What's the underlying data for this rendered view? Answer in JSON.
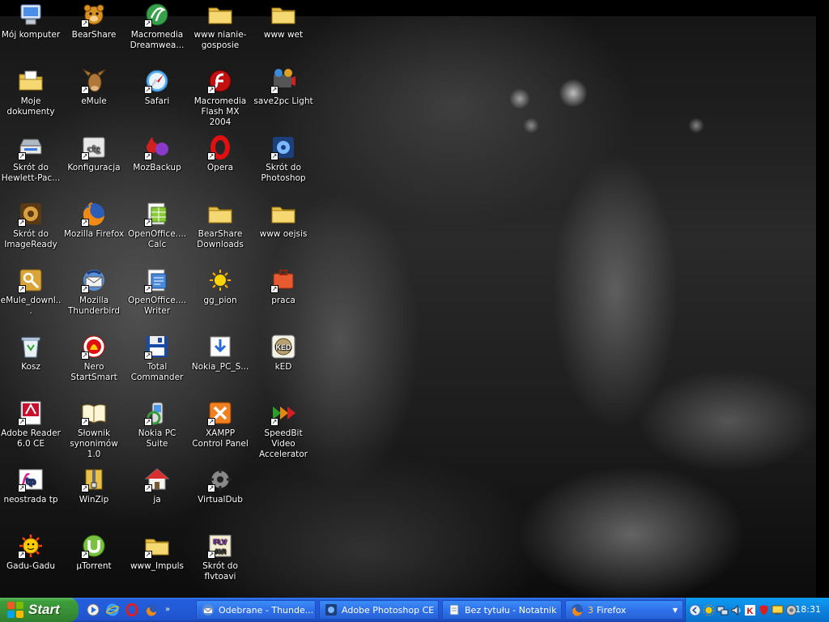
{
  "desktop": {
    "icons": [
      {
        "label": "Mój komputer",
        "icon": "my-computer-icon",
        "shortcut": false
      },
      {
        "label": "Moje dokumenty",
        "icon": "my-documents-icon",
        "shortcut": false
      },
      {
        "label": "Skrót do Hewlett-Pac...",
        "icon": "hp-scanner-icon",
        "shortcut": true
      },
      {
        "label": "Skrót do ImageReady",
        "icon": "imageready-icon",
        "shortcut": true
      },
      {
        "label": "eMule_downl...",
        "icon": "emule-folder-icon",
        "shortcut": true
      },
      {
        "label": "Kosz",
        "icon": "recycle-bin-icon",
        "shortcut": false
      },
      {
        "label": "Adobe Reader 6.0 CE",
        "icon": "adobe-reader-icon",
        "shortcut": true
      },
      {
        "label": "neostrada tp",
        "icon": "neostrada-tp-icon",
        "shortcut": true
      },
      {
        "label": "Gadu-Gadu",
        "icon": "gadu-gadu-icon",
        "shortcut": true
      },
      {
        "label": "BearShare",
        "icon": "bearshare-icon",
        "shortcut": true
      },
      {
        "label": "eMule",
        "icon": "emule-icon",
        "shortcut": true
      },
      {
        "label": "Konfiguracja",
        "icon": "config-icon",
        "shortcut": true
      },
      {
        "label": "Mozilla Firefox",
        "icon": "firefox-icon",
        "shortcut": true
      },
      {
        "label": "Mozilla Thunderbird",
        "icon": "thunderbird-icon",
        "shortcut": true
      },
      {
        "label": "Nero StartSmart",
        "icon": "nero-icon",
        "shortcut": true
      },
      {
        "label": "Słownik synonimów 1.0",
        "icon": "dictionary-icon",
        "shortcut": true
      },
      {
        "label": "WinZip",
        "icon": "winzip-icon",
        "shortcut": true
      },
      {
        "label": "µTorrent",
        "icon": "utorrent-icon",
        "shortcut": true
      },
      {
        "label": "Macromedia Dreamwea...",
        "icon": "dreamweaver-icon",
        "shortcut": true
      },
      {
        "label": "Safari",
        "icon": "safari-icon",
        "shortcut": true
      },
      {
        "label": "MozBackup",
        "icon": "mozbackup-icon",
        "shortcut": true
      },
      {
        "label": "OpenOffice.... Calc",
        "icon": "oo-calc-icon",
        "shortcut": true
      },
      {
        "label": "OpenOffice.... Writer",
        "icon": "oo-writer-icon",
        "shortcut": true
      },
      {
        "label": "Total Commander",
        "icon": "total-commander-icon",
        "shortcut": true
      },
      {
        "label": "Nokia PC Suite",
        "icon": "nokia-pc-suite-icon",
        "shortcut": true
      },
      {
        "label": "ja",
        "icon": "home-icon",
        "shortcut": true
      },
      {
        "label": "www_Impuls",
        "icon": "folder-icon",
        "shortcut": true
      },
      {
        "label": "www nianie-gosposie",
        "icon": "folder-icon",
        "shortcut": false
      },
      {
        "label": "Macromedia Flash MX 2004",
        "icon": "flash-icon",
        "shortcut": true
      },
      {
        "label": "Opera",
        "icon": "opera-icon",
        "shortcut": true
      },
      {
        "label": "BearShare Downloads",
        "icon": "folder-icon",
        "shortcut": false
      },
      {
        "label": "gg_pion",
        "icon": "gg-sun-icon",
        "shortcut": false
      },
      {
        "label": "Nokia_PC_S...",
        "icon": "installer-icon",
        "shortcut": false
      },
      {
        "label": "XAMPP Control Panel",
        "icon": "xampp-icon",
        "shortcut": true
      },
      {
        "label": "VirtualDub",
        "icon": "virtualdub-icon",
        "shortcut": true
      },
      {
        "label": "Skrót do flvtoavi",
        "icon": "flv-icon",
        "shortcut": true
      },
      {
        "label": "www wet",
        "icon": "folder-icon",
        "shortcut": false
      },
      {
        "label": "save2pc Light",
        "icon": "save2pc-icon",
        "shortcut": true
      },
      {
        "label": "Skrót do Photoshop",
        "icon": "photoshop-icon",
        "shortcut": true
      },
      {
        "label": "www oejsis",
        "icon": "folder-icon",
        "shortcut": false
      },
      {
        "label": "praca",
        "icon": "praca-icon",
        "shortcut": true
      },
      {
        "label": "kED",
        "icon": "ked-icon",
        "shortcut": false
      },
      {
        "label": "SpeedBit Video Accelerator",
        "icon": "speedbit-icon",
        "shortcut": true
      }
    ]
  },
  "taskbar": {
    "start_label": "Start",
    "quick_launch": [
      {
        "icon": "windows-media-player-icon"
      },
      {
        "icon": "internet-explorer-icon"
      },
      {
        "icon": "opera-icon"
      },
      {
        "icon": "firefox-icon"
      }
    ],
    "tasks": [
      {
        "label": "Odebrane - Thunde...",
        "icon": "thunderbird-icon"
      },
      {
        "label": "Adobe Photoshop CE",
        "icon": "photoshop-icon"
      },
      {
        "label": "Bez tytułu - Notatnik",
        "icon": "notepad-icon"
      },
      {
        "label": "Firefox",
        "count": "3",
        "icon": "firefox-icon"
      }
    ],
    "tray_icons": [
      "hide-tray-arrow-icon",
      "gg-sun-icon",
      "network-icon",
      "volume-icon",
      "antivirus-icon",
      "security-icon",
      "display-icon",
      "update-icon"
    ],
    "clock": "18:31"
  }
}
